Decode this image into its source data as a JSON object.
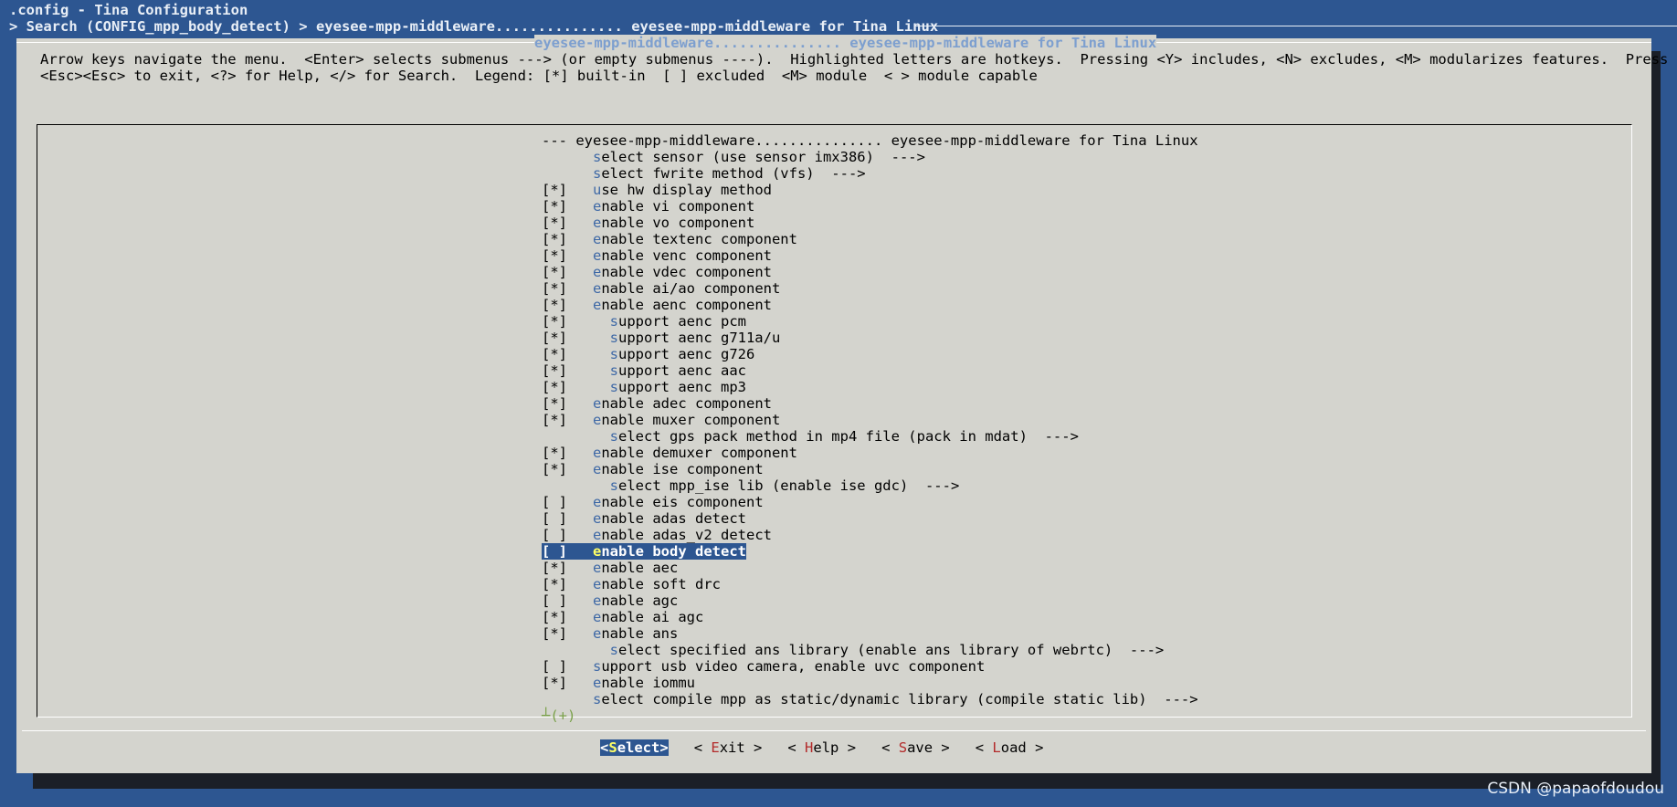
{
  "window": {
    "title": ".config - Tina Configuration",
    "breadcrumb": "> Search (CONFIG_mpp_body_detect) > eyesee-mpp-middleware............... eyesee-mpp-middleware for Tina Linux"
  },
  "dialog": {
    "title": "eyesee-mpp-middleware............... eyesee-mpp-middleware for Tina Linux",
    "help_line1": "Arrow keys navigate the menu.  <Enter> selects submenus ---> (or empty submenus ----).  Highlighted letters are hotkeys.  Pressing <Y> includes, <N> excludes, <M> modularizes features.  Press",
    "help_line2": "<Esc><Esc> to exit, <?> for Help, </> for Search.  Legend: [*] built-in  [ ] excluded  <M> module  < > module capable"
  },
  "menu": {
    "items": [
      {
        "prefix": "--- ",
        "hotkey": "",
        "text": "eyesee-mpp-middleware............... eyesee-mpp-middleware for Tina Linux"
      },
      {
        "prefix": "      ",
        "hotkey": "s",
        "text": "elect sensor (use sensor imx386)  --->"
      },
      {
        "prefix": "      ",
        "hotkey": "s",
        "text": "elect fwrite method (vfs)  --->"
      },
      {
        "prefix": "[*]   ",
        "hotkey": "u",
        "text": "se hw display method"
      },
      {
        "prefix": "[*]   ",
        "hotkey": "e",
        "text": "nable vi component"
      },
      {
        "prefix": "[*]   ",
        "hotkey": "e",
        "text": "nable vo component"
      },
      {
        "prefix": "[*]   ",
        "hotkey": "e",
        "text": "nable textenc component"
      },
      {
        "prefix": "[*]   ",
        "hotkey": "e",
        "text": "nable venc component"
      },
      {
        "prefix": "[*]   ",
        "hotkey": "e",
        "text": "nable vdec component"
      },
      {
        "prefix": "[*]   ",
        "hotkey": "e",
        "text": "nable ai/ao component"
      },
      {
        "prefix": "[*]   ",
        "hotkey": "e",
        "text": "nable aenc component"
      },
      {
        "prefix": "[*]     ",
        "hotkey": "s",
        "text": "upport aenc pcm"
      },
      {
        "prefix": "[*]     ",
        "hotkey": "s",
        "text": "upport aenc g711a/u"
      },
      {
        "prefix": "[*]     ",
        "hotkey": "s",
        "text": "upport aenc g726"
      },
      {
        "prefix": "[*]     ",
        "hotkey": "s",
        "text": "upport aenc aac"
      },
      {
        "prefix": "[*]     ",
        "hotkey": "s",
        "text": "upport aenc mp3"
      },
      {
        "prefix": "[*]   ",
        "hotkey": "e",
        "text": "nable adec component"
      },
      {
        "prefix": "[*]   ",
        "hotkey": "e",
        "text": "nable muxer component"
      },
      {
        "prefix": "        ",
        "hotkey": "s",
        "text": "elect gps pack method in mp4 file (pack in mdat)  --->"
      },
      {
        "prefix": "[*]   ",
        "hotkey": "e",
        "text": "nable demuxer component"
      },
      {
        "prefix": "[*]   ",
        "hotkey": "e",
        "text": "nable ise component"
      },
      {
        "prefix": "        ",
        "hotkey": "s",
        "text": "elect mpp_ise lib (enable ise gdc)  --->"
      },
      {
        "prefix": "[ ]   ",
        "hotkey": "e",
        "text": "nable eis component"
      },
      {
        "prefix": "[ ]   ",
        "hotkey": "e",
        "text": "nable adas detect"
      },
      {
        "prefix": "[ ]   ",
        "hotkey": "e",
        "text": "nable adas_v2 detect"
      },
      {
        "prefix": "[ ]   ",
        "hotkey": "e",
        "text": "nable body detect",
        "selected": true
      },
      {
        "prefix": "[*]   ",
        "hotkey": "e",
        "text": "nable aec"
      },
      {
        "prefix": "[*]   ",
        "hotkey": "e",
        "text": "nable soft drc"
      },
      {
        "prefix": "[ ]   ",
        "hotkey": "e",
        "text": "nable agc"
      },
      {
        "prefix": "[*]   ",
        "hotkey": "e",
        "text": "nable ai agc"
      },
      {
        "prefix": "[*]   ",
        "hotkey": "e",
        "text": "nable ans"
      },
      {
        "prefix": "        ",
        "hotkey": "s",
        "text": "elect specified ans library (enable ans library of webrtc)  --->"
      },
      {
        "prefix": "[ ]   ",
        "hotkey": "s",
        "text": "upport usb video camera, enable uvc component"
      },
      {
        "prefix": "[*]   ",
        "hotkey": "e",
        "text": "nable iommu"
      },
      {
        "prefix": "      ",
        "hotkey": "s",
        "text": "elect compile mpp as static/dynamic library (compile static lib)  --->"
      }
    ],
    "more_indicator": "┴(+)"
  },
  "buttons": [
    {
      "pre": "<",
      "hotkey": "S",
      "rest": "elect>",
      "active": true
    },
    {
      "pre": "< ",
      "hotkey": "E",
      "rest": "xit >",
      "active": false
    },
    {
      "pre": "< ",
      "hotkey": "H",
      "rest": "elp >",
      "active": false
    },
    {
      "pre": "< ",
      "hotkey": "S",
      "rest": "ave >",
      "active": false
    },
    {
      "pre": "< ",
      "hotkey": "L",
      "rest": "oad >",
      "active": false
    }
  ],
  "watermark": "CSDN @papaofdoudou",
  "colors": {
    "background": "#2d5691",
    "dialog": "#d4d4ce",
    "hotkey": "#3f69a6",
    "button_hotkey": "#b32b2b"
  }
}
